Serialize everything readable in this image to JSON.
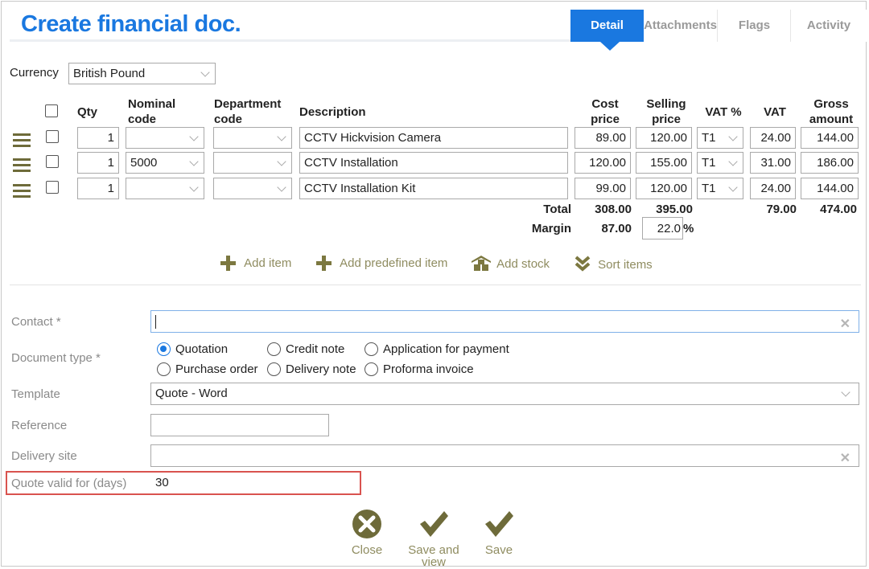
{
  "page": {
    "title": "Create financial doc."
  },
  "tabs": [
    {
      "label": "Detail",
      "active": true
    },
    {
      "label": "Attachments"
    },
    {
      "label": "Flags"
    },
    {
      "label": "Activity"
    }
  ],
  "currency": {
    "label": "Currency",
    "value": "British Pound"
  },
  "table": {
    "headers": {
      "qty": "Qty",
      "nominal": [
        "Nominal",
        "code"
      ],
      "department": [
        "Department",
        "code"
      ],
      "description": "Description",
      "cost": [
        "Cost",
        "price"
      ],
      "selling": [
        "Selling",
        "price"
      ],
      "vat_pct": "VAT %",
      "vat": "VAT",
      "gross": [
        "Gross",
        "amount"
      ]
    },
    "rows": [
      {
        "qty": "1",
        "nominal": "",
        "department": "",
        "description": "CCTV Hickvision Camera",
        "cost": "89.00",
        "selling": "120.00",
        "vat_code": "T1",
        "vat": "24.00",
        "gross": "144.00"
      },
      {
        "qty": "1",
        "nominal": "5000",
        "department": "",
        "description": "CCTV Installation",
        "cost": "120.00",
        "selling": "155.00",
        "vat_code": "T1",
        "vat": "31.00",
        "gross": "186.00"
      },
      {
        "qty": "1",
        "nominal": "",
        "department": "",
        "description": "CCTV Installation Kit",
        "cost": "99.00",
        "selling": "120.00",
        "vat_code": "T1",
        "vat": "24.00",
        "gross": "144.00"
      }
    ],
    "total": {
      "label": "Total",
      "cost": "308.00",
      "selling": "395.00",
      "vat": "79.00",
      "gross": "474.00"
    },
    "margin": {
      "label": "Margin",
      "value": "87.00",
      "percent": "22.0",
      "percent_sign": "%"
    }
  },
  "actions": {
    "add_item": "Add item",
    "add_predefined": "Add predefined item",
    "add_stock": "Add stock",
    "sort_items": "Sort items"
  },
  "form": {
    "contact_label": "Contact *",
    "contact_value": "",
    "doctype_label": "Document type *",
    "doctypes": [
      {
        "label": "Quotation",
        "selected": true
      },
      {
        "label": "Credit note"
      },
      {
        "label": "Application for payment"
      },
      {
        "label": "Purchase order"
      },
      {
        "label": "Delivery note"
      },
      {
        "label": "Proforma invoice"
      }
    ],
    "template_label": "Template",
    "template_value": "Quote - Word",
    "reference_label": "Reference",
    "reference_value": "",
    "delivery_label": "Delivery site",
    "delivery_value": "",
    "valid_label": "Quote valid for (days)",
    "valid_value": "30"
  },
  "buttons": {
    "close": "Close",
    "save_view": [
      "Save and",
      "view"
    ],
    "save": "Save"
  },
  "colors": {
    "accent": "#1a78e0",
    "olive": "#7c7840",
    "highlight": "#d9534f"
  }
}
